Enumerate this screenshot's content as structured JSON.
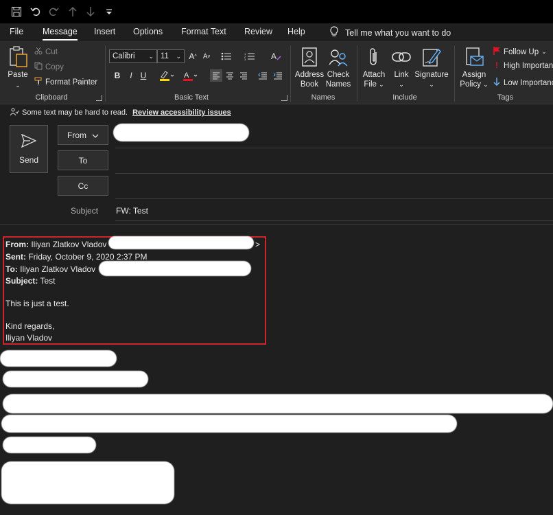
{
  "qat": {
    "buttons": [
      "save-icon",
      "undo-icon",
      "redo-icon",
      "up-icon",
      "down-icon",
      "customize-icon"
    ]
  },
  "tabs": [
    {
      "label": "File"
    },
    {
      "label": "Message",
      "active": true
    },
    {
      "label": "Insert"
    },
    {
      "label": "Options"
    },
    {
      "label": "Format Text"
    },
    {
      "label": "Review"
    },
    {
      "label": "Help"
    }
  ],
  "tellme": "Tell me what you want to do",
  "ribbon": {
    "clipboard": {
      "label": "Clipboard",
      "paste": "Paste",
      "cut": "Cut",
      "copy": "Copy",
      "format_painter": "Format Painter"
    },
    "basic_text": {
      "label": "Basic Text",
      "font": "Calibri",
      "size": "11",
      "bold": "B",
      "italic": "I",
      "underline": "U"
    },
    "names": {
      "label": "Names",
      "address_book": [
        "Address",
        "Book"
      ],
      "check_names": [
        "Check",
        "Names"
      ]
    },
    "include": {
      "label": "Include",
      "attach": [
        "Attach",
        "File"
      ],
      "link": "Link",
      "signature": "Signature"
    },
    "tags": {
      "label": "Tags",
      "assign_policy": [
        "Assign",
        "Policy"
      ],
      "follow_up": "Follow Up",
      "high_importance": "High Importanc",
      "low_importance": "Low Importanc"
    }
  },
  "infobar": {
    "text": "Some text may be hard to read.",
    "link": "Review accessibility issues"
  },
  "compose": {
    "send": "Send",
    "from": "From",
    "to": "To",
    "cc": "Cc",
    "subject_label": "Subject",
    "subject_value": "FW: Test"
  },
  "body": {
    "from_label": "From:",
    "from_value": "Iliyan Zlatkov Vladov",
    "from_suffix": ">",
    "sent_label": "Sent:",
    "sent_value": "Friday, October 9, 2020 2:37 PM",
    "to_label": "To:",
    "to_value": "Iliyan Zlatkov Vladov",
    "subject_label": "Subject:",
    "subject_value": "Test",
    "message": "This is just a test.",
    "regards": "Kind regards,",
    "signature": "Iliyan Vladov"
  },
  "colors": {
    "accent_red": "#d1232a",
    "highlight_yellow": "#ffd800",
    "font_red": "#e81123",
    "icon_blue": "#6ab7ff"
  }
}
